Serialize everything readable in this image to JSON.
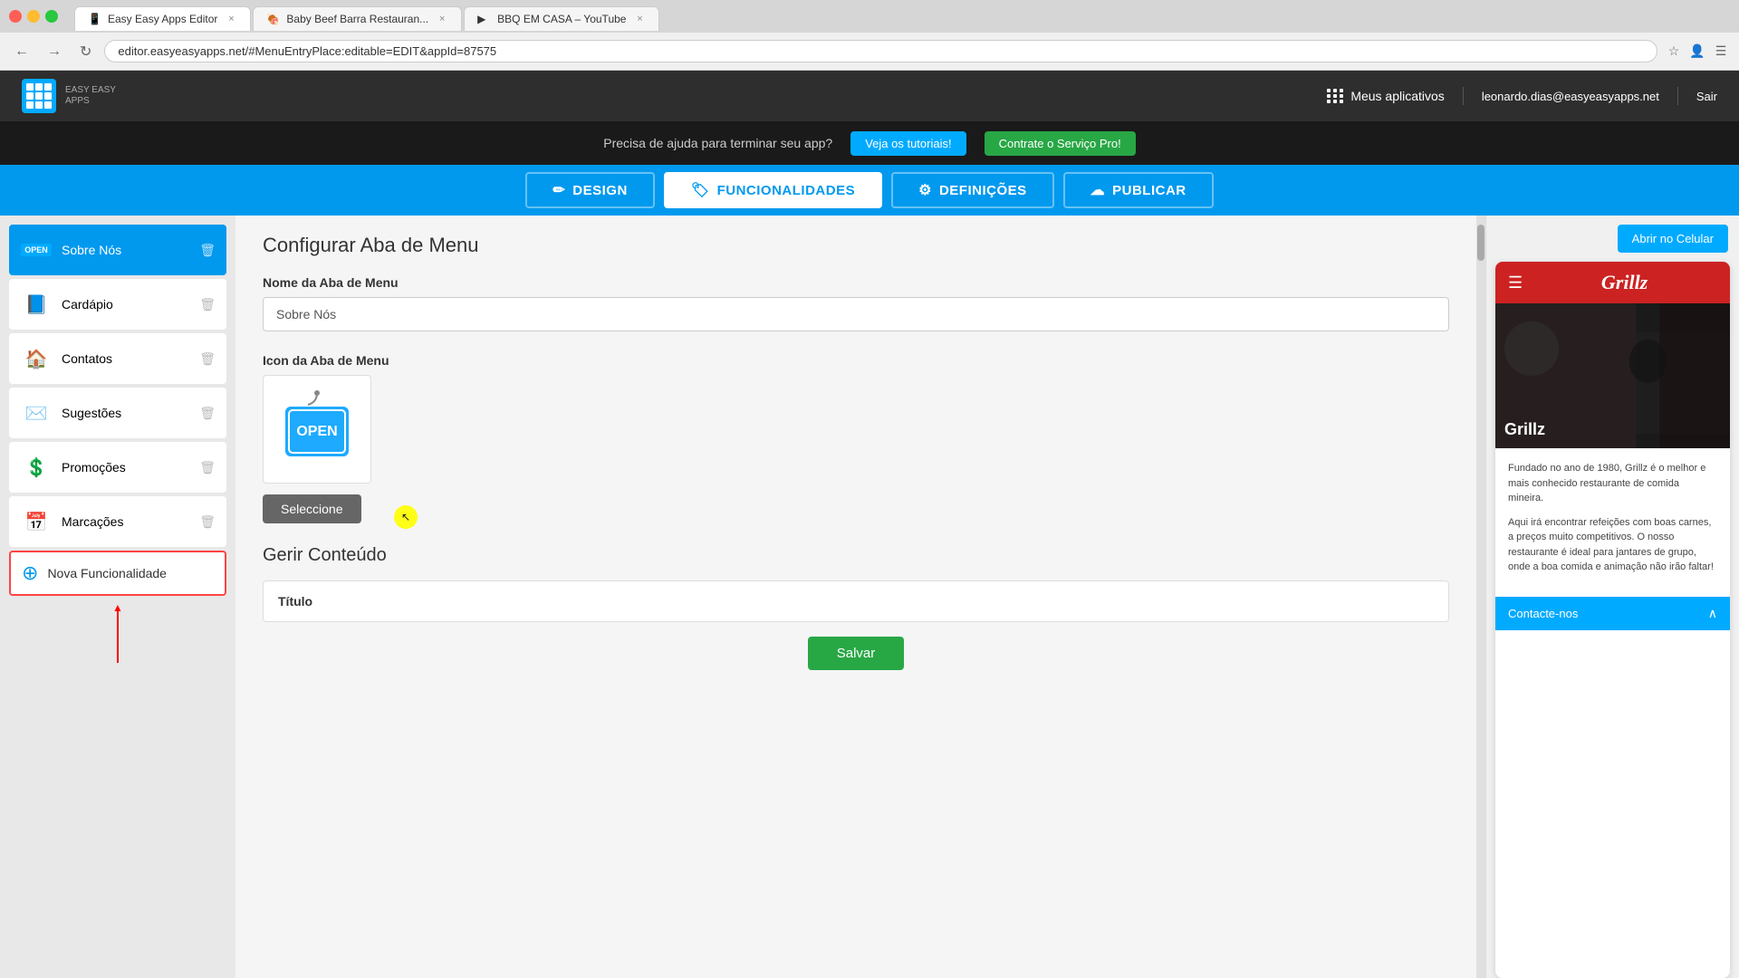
{
  "browser": {
    "tabs": [
      {
        "label": "Easy Easy Apps Editor",
        "favicon": "📱",
        "active": true
      },
      {
        "label": "Baby Beef Barra Restauran...",
        "favicon": "🍖",
        "active": false
      },
      {
        "label": "BBQ EM CASA – YouTube",
        "favicon": "▶",
        "active": false
      }
    ],
    "address": "editor.easyeasyapps.net/#MenuEntryPlace:editable=EDIT&appId=87575",
    "back_btn": "←",
    "forward_btn": "→",
    "reload_btn": "↻"
  },
  "header": {
    "logo_text": "EASY EASY",
    "logo_subtext": "APPS",
    "apps_label": "Meus aplicativos",
    "user_email": "leonardo.dias@easyeasyapps.net",
    "sair_label": "Sair"
  },
  "banner": {
    "text": "Precisa de ajuda para terminar seu app?",
    "tutorials_btn": "Veja os tutoriais!",
    "pro_btn": "Contrate o Serviço Pro!"
  },
  "nav_tabs": [
    {
      "label": "DESIGN",
      "icon": "✏️",
      "active": false
    },
    {
      "label": "FUNCIONALIDADES",
      "icon": "🏷️",
      "active": true
    },
    {
      "label": "DEFINIÇÕES",
      "icon": "⚙️",
      "active": false
    },
    {
      "label": "PUBLICAR",
      "icon": "☁️",
      "active": false
    }
  ],
  "sidebar": {
    "items": [
      {
        "label": "Sobre Nós",
        "icon": "🔖",
        "active": true,
        "badge": "OPEN"
      },
      {
        "label": "Cardápio",
        "icon": "📘",
        "active": false
      },
      {
        "label": "Contatos",
        "icon": "🏠",
        "active": false
      },
      {
        "label": "Sugestões",
        "icon": "✉️",
        "active": false
      },
      {
        "label": "Promoções",
        "icon": "💲",
        "active": false
      },
      {
        "label": "Marcações",
        "icon": "📅",
        "active": false
      }
    ],
    "new_func_label": "Nova Funcionalidade"
  },
  "editor": {
    "section_title": "Configurar Aba de Menu",
    "nome_label": "Nome da Aba de Menu",
    "nome_placeholder": "Sobre Nós",
    "nome_value": "Sobre Nós",
    "icon_label": "Icon da Aba de Menu",
    "select_btn": "Seleccione",
    "gerir_title": "Gerir Conteúdo",
    "titulo_label": "Título",
    "save_btn": "Salvar"
  },
  "preview": {
    "open_mobile_btn": "Abrir no Celular",
    "restaurant_name": "Grillz",
    "restaurant_name_overlay": "Grillz",
    "body_text1": "Fundado no ano de 1980, Grillz é o melhor e mais conhecido restaurante de comida mineira.",
    "body_text2": "Aqui irá encontrar refeições com boas carnes, a preços muito competitivos. O nosso restaurante é ideal para jantares de grupo, onde a boa comida e animação não irão faltar!",
    "contacte_label": "Contacte-nos",
    "chevron": "∧"
  }
}
